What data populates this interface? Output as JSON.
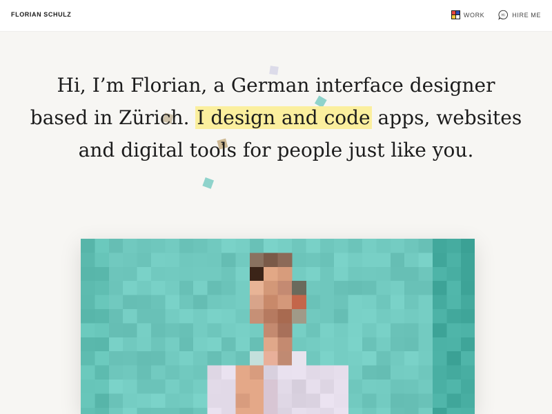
{
  "header": {
    "brand": "FLORIAN SCHULZ",
    "nav": [
      {
        "label": "WORK",
        "icon": "mondrian-grid-icon"
      },
      {
        "label": "HIRE ME",
        "icon": "speech-bubble-hi-icon",
        "icon_text": "Hi"
      }
    ]
  },
  "hero": {
    "line_before": "Hi, I’m Florian, a German interface designer based in Zürich.",
    "highlight": "I design and code",
    "line_after": "apps, websites and digital tools for people just like you.",
    "highlight_color": "#fbef9e"
  },
  "portrait": {
    "type": "pixelated-photo",
    "background_color": "#6dc2b9"
  }
}
